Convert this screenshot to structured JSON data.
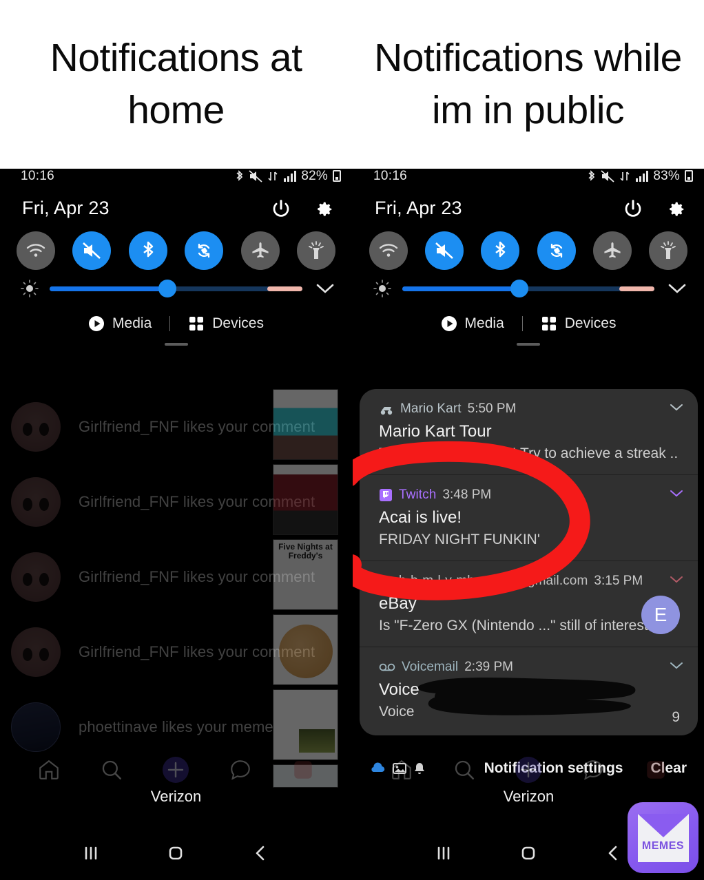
{
  "captions": {
    "left": "Notifications at home",
    "right": "Notifications while im in public"
  },
  "status_bar": {
    "time": "10:16",
    "battery_left": "82%",
    "battery_right": "83%",
    "icons": [
      "bluetooth-icon",
      "mute-icon",
      "data-transfer-icon",
      "signal-icon",
      "battery-icon"
    ]
  },
  "quick_panel": {
    "date": "Fri, Apr 23",
    "power_icon": "power-icon",
    "settings_icon": "gear-icon",
    "toggles": [
      {
        "name": "wifi",
        "label": "Wi-Fi",
        "state": "off"
      },
      {
        "name": "mute",
        "label": "Mute",
        "state": "on"
      },
      {
        "name": "bluetooth",
        "label": "Bluetooth",
        "state": "on"
      },
      {
        "name": "auto-rotate",
        "label": "Auto rotate",
        "state": "on"
      },
      {
        "name": "airplane",
        "label": "Airplane mode",
        "state": "off"
      },
      {
        "name": "flashlight",
        "label": "Flashlight",
        "state": "off"
      }
    ],
    "brightness": {
      "value": 44,
      "icon": "brightness-icon",
      "expand_icon": "chevron-down-icon"
    },
    "media_label": "Media",
    "devices_label": "Devices"
  },
  "left_panel": {
    "notifications": [
      {
        "text": "Girlfriend_FNF likes your comment",
        "avatar": "pink",
        "thumb": "teal"
      },
      {
        "text": "Girlfriend_FNF likes your comment",
        "avatar": "pink",
        "thumb": "red"
      },
      {
        "text": "Girlfriend_FNF likes your comment",
        "avatar": "pink",
        "thumb": "fnaf"
      },
      {
        "text": "Girlfriend_FNF likes your comment",
        "avatar": "pink",
        "thumb": "cookie"
      },
      {
        "text": "phoettinave likes your meme",
        "avatar": "navy",
        "thumb": "light"
      }
    ],
    "thumb_fnaf_text": "Five Nights at Freddy's",
    "bottom_nav": [
      "home-icon",
      "search-icon",
      "add-post-icon",
      "messages-icon",
      "profile-icon"
    ]
  },
  "right_panel": {
    "notifications": [
      {
        "app": "Mario Kart",
        "app_icon": "mario-kart-icon",
        "app_color": "#b9c4c9",
        "time": "5:50 PM",
        "title": "Mario Kart Tour",
        "body": "The Kart Pipe is now! Try to achieve a streak ..",
        "chevron": "chevron-down-icon"
      },
      {
        "app": "Twitch",
        "app_icon": "twitch-icon",
        "app_color": "#a970ff",
        "time": "3:48 PM",
        "title": "Acai is live!",
        "body": "FRIDAY NIGHT FUNKIN'",
        "chevron": "chevron-down-icon",
        "highlighted": true
      },
      {
        "app": "b-b-m-l-y-mbrocko7@gmail.com",
        "app_icon": "gmail-icon",
        "app_color": "#c0c0c0",
        "time": "3:15 PM",
        "title": "eBay",
        "body": "Is \"F-Zero GX (Nintendo ...\" still of interest? ..",
        "avatar_letter": "E",
        "avatar_color": "#8f93e0",
        "chevron": "chevron-down-icon"
      },
      {
        "app": "Voicemail",
        "app_icon": "voicemail-icon",
        "app_color": "#9fb6bf",
        "time": "2:39 PM",
        "title": "Voice",
        "body": "Voice",
        "badge": "9",
        "chevron": "chevron-down-icon",
        "redacted": true
      }
    ],
    "actions": {
      "settings_label": "Notification settings",
      "clear_label": "Clear",
      "icons": [
        "cloud-icon",
        "image-icon",
        "bell-icon"
      ]
    },
    "bottom_nav": [
      "home-icon",
      "search-icon",
      "add-post-icon",
      "messages-icon",
      "profile-icon"
    ]
  },
  "carrier": "Verizon",
  "system_nav": [
    "recents-icon",
    "home-icon",
    "back-icon"
  ],
  "watermark": {
    "label": "MEMES",
    "color": "#8a5cf0"
  },
  "annotation": {
    "type": "red-circle",
    "color": "#f51a19",
    "targets": "twitch-notification"
  }
}
